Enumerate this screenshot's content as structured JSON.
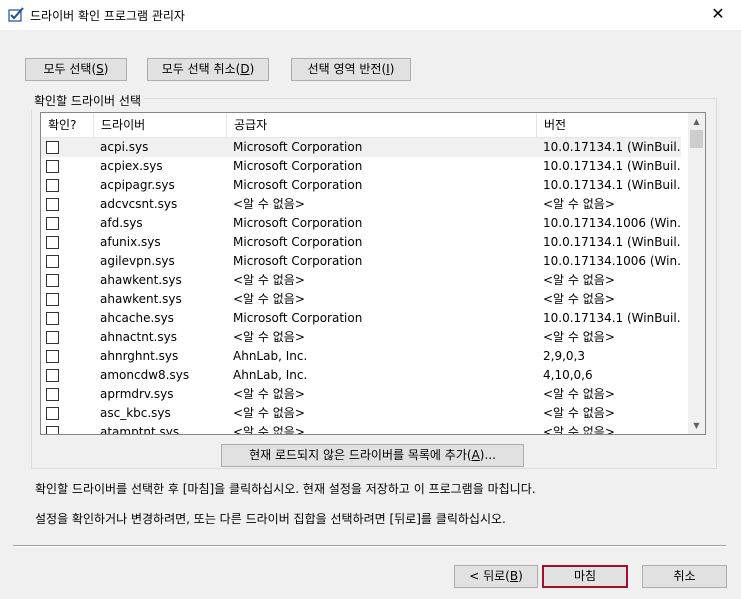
{
  "window": {
    "title": "드라이버 확인 프로그램 관리자",
    "close_glyph": "✕"
  },
  "toolbar": {
    "select_all": "모두 선택",
    "select_all_key": "S",
    "deselect_all": "모두 선택 취소",
    "deselect_all_key": "D",
    "invert_selection": "선택 영역 반전",
    "invert_selection_key": "I"
  },
  "group": {
    "label": "확인할 드라이버 선택"
  },
  "table": {
    "columns": [
      "확인?",
      "드라이버",
      "공급자",
      "버전"
    ],
    "rows": [
      {
        "driver": "acpi.sys",
        "provider": "Microsoft Corporation",
        "version": "10.0.17134.1 (WinBuil..."
      },
      {
        "driver": "acpiex.sys",
        "provider": "Microsoft Corporation",
        "version": "10.0.17134.1 (WinBuil..."
      },
      {
        "driver": "acpipagr.sys",
        "provider": "Microsoft Corporation",
        "version": "10.0.17134.1 (WinBuil..."
      },
      {
        "driver": "adcvcsnt.sys",
        "provider": "<알 수 없음>",
        "version": "<알 수 없음>"
      },
      {
        "driver": "afd.sys",
        "provider": "Microsoft Corporation",
        "version": "10.0.17134.1006 (Win..."
      },
      {
        "driver": "afunix.sys",
        "provider": "Microsoft Corporation",
        "version": "10.0.17134.1 (WinBuil..."
      },
      {
        "driver": "agilevpn.sys",
        "provider": "Microsoft Corporation",
        "version": "10.0.17134.1006 (Win..."
      },
      {
        "driver": "ahawkent.sys",
        "provider": "<알 수 없음>",
        "version": "<알 수 없음>"
      },
      {
        "driver": "ahawkent.sys",
        "provider": "<알 수 없음>",
        "version": "<알 수 없음>"
      },
      {
        "driver": "ahcache.sys",
        "provider": "Microsoft Corporation",
        "version": "10.0.17134.1 (WinBuil..."
      },
      {
        "driver": "ahnactnt.sys",
        "provider": "<알 수 없음>",
        "version": "<알 수 없음>"
      },
      {
        "driver": "ahnrghnt.sys",
        "provider": "AhnLab, Inc.",
        "version": "2,9,0,3"
      },
      {
        "driver": "amoncdw8.sys",
        "provider": "AhnLab, Inc.",
        "version": "4,10,0,6"
      },
      {
        "driver": "aprmdrv.sys",
        "provider": "<알 수 없음>",
        "version": "<알 수 없음>"
      },
      {
        "driver": "asc_kbc.sys",
        "provider": "<알 수 없음>",
        "version": "<알 수 없음>"
      },
      {
        "driver": "atamptnt.sys",
        "provider": "<알 수 없음>",
        "version": "<알 수 없음>"
      }
    ]
  },
  "add_button": {
    "label": "현재 로드되지 않은 드라이버를 목록에 추가",
    "key": "A",
    "suffix": "..."
  },
  "instructions": {
    "line1": "확인할 드라이버를 선택한 후 [마침]을 클릭하십시오. 현재 설정을 저장하고 이 프로그램을 마칩니다.",
    "line2": "설정을 확인하거나 변경하려면, 또는 다른 드라이버 집합을 선택하려면 [뒤로]를 클릭하십시오."
  },
  "footer": {
    "back": "< 뒤로",
    "back_key": "B",
    "finish": "마침",
    "cancel": "취소"
  },
  "colors": {
    "dialog_bg": "#f0f0f0",
    "default_button_border": "#a0102a"
  }
}
